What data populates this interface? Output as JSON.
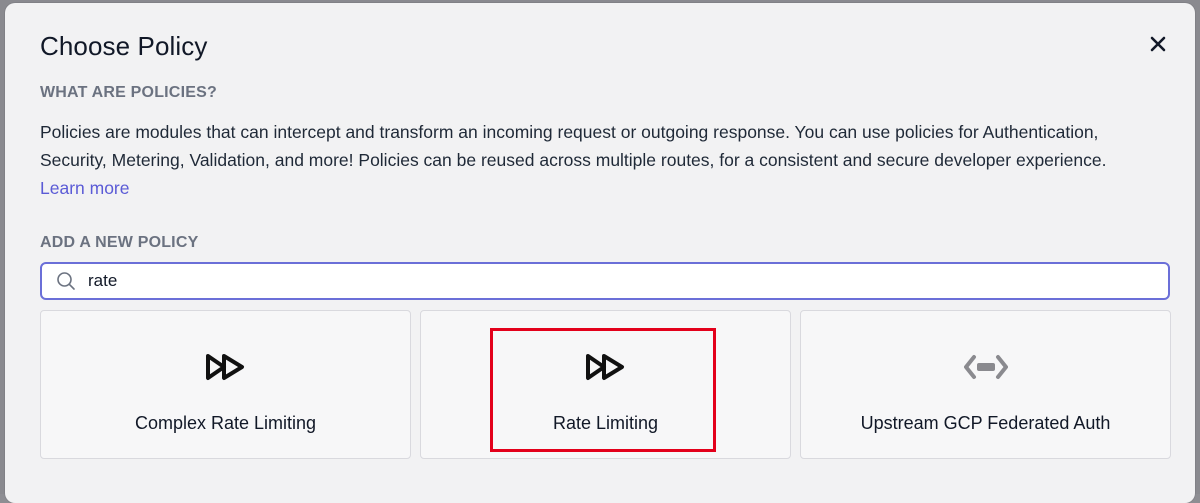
{
  "dialog": {
    "title": "Choose Policy",
    "close_icon": "close-icon"
  },
  "about": {
    "heading": "WHAT ARE POLICIES?",
    "text": "Policies are modules that can intercept and transform an incoming request or outgoing response. You can use policies for Authentication, Security, Metering, Validation, and more! Policies can be reused across multiple routes, for a consistent and secure developer experience.",
    "link_label": "Learn more"
  },
  "add": {
    "heading": "ADD A NEW POLICY",
    "search_value": "rate"
  },
  "policies": [
    {
      "name": "Complex Rate Limiting",
      "icon": "fast-forward-icon"
    },
    {
      "name": "Rate Limiting",
      "icon": "fast-forward-icon"
    },
    {
      "name": "Upstream GCP Federated Auth",
      "icon": "code-brackets-icon"
    }
  ],
  "colors": {
    "link": "#5b5bd6",
    "search_border": "#6b6fd8",
    "highlight": "#e3001b"
  }
}
